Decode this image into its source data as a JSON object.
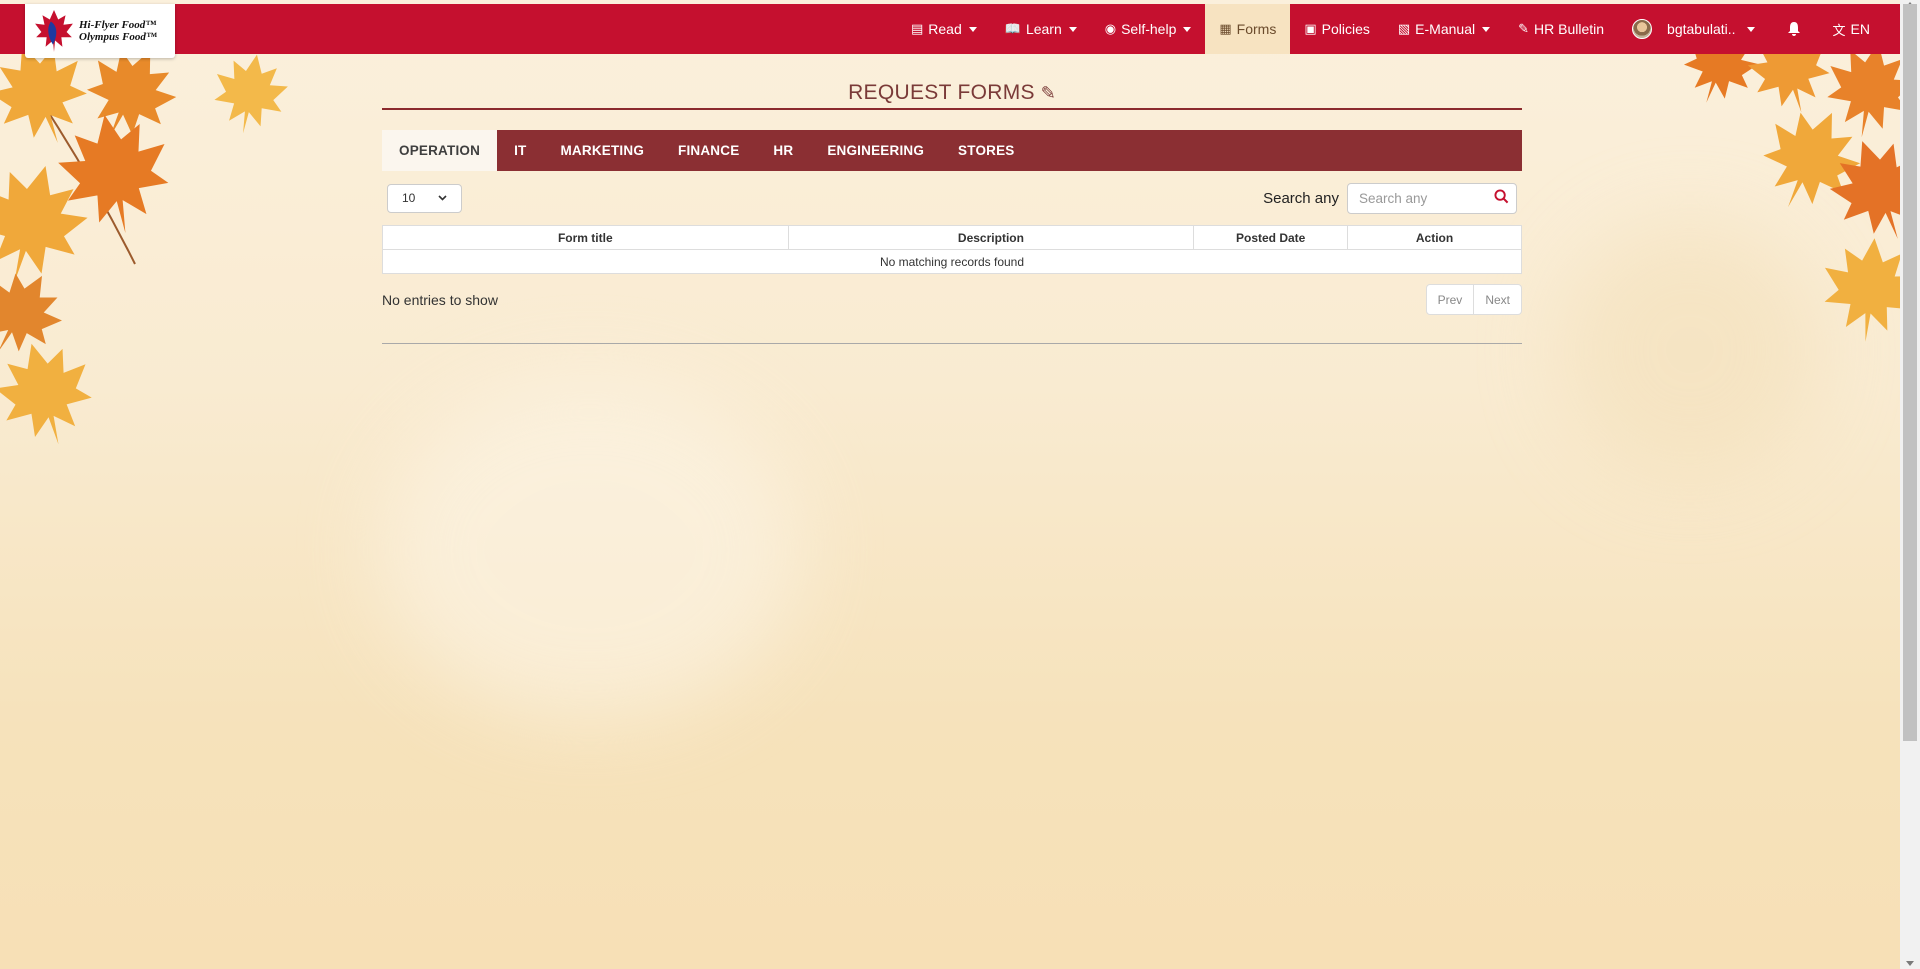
{
  "logo": {
    "line1": "Hi-Flyer Food™",
    "line2": "Olympus Food™"
  },
  "nav": [
    {
      "label": "Read",
      "icon": "newspaper-icon",
      "caret": true,
      "active": false
    },
    {
      "label": "Learn",
      "icon": "book-icon",
      "caret": true,
      "active": false
    },
    {
      "label": "Self-help",
      "icon": "person-circle-icon",
      "caret": true,
      "active": false
    },
    {
      "label": "Forms",
      "icon": "form-icon",
      "caret": false,
      "active": true
    },
    {
      "label": "Policies",
      "icon": "policy-icon",
      "caret": false,
      "active": false
    },
    {
      "label": "E-Manual",
      "icon": "manual-icon",
      "caret": true,
      "active": false
    },
    {
      "label": "HR Bulletin",
      "icon": "pin-icon",
      "caret": false,
      "active": false
    }
  ],
  "user": {
    "name": "bgtabulati..",
    "icon": "avatar"
  },
  "language": "EN",
  "page": {
    "title": "REQUEST FORMS"
  },
  "tabs": [
    "OPERATION",
    "IT",
    "MARKETING",
    "FINANCE",
    "HR",
    "ENGINEERING",
    "STORES"
  ],
  "table_controls": {
    "page_length": "10",
    "search_label": "Search any",
    "search_placeholder": "Search any"
  },
  "table": {
    "columns": [
      "Form title",
      "Description",
      "Posted Date",
      "Action"
    ],
    "empty_message": "No matching records found",
    "info": "No entries to show",
    "prev_label": "Prev",
    "next_label": "Next"
  },
  "colors": {
    "brand_red": "#c5102f",
    "tab_bar": "#8b2f33",
    "title": "#7a3a38",
    "active_nav_bg": "#f7e3c1"
  }
}
